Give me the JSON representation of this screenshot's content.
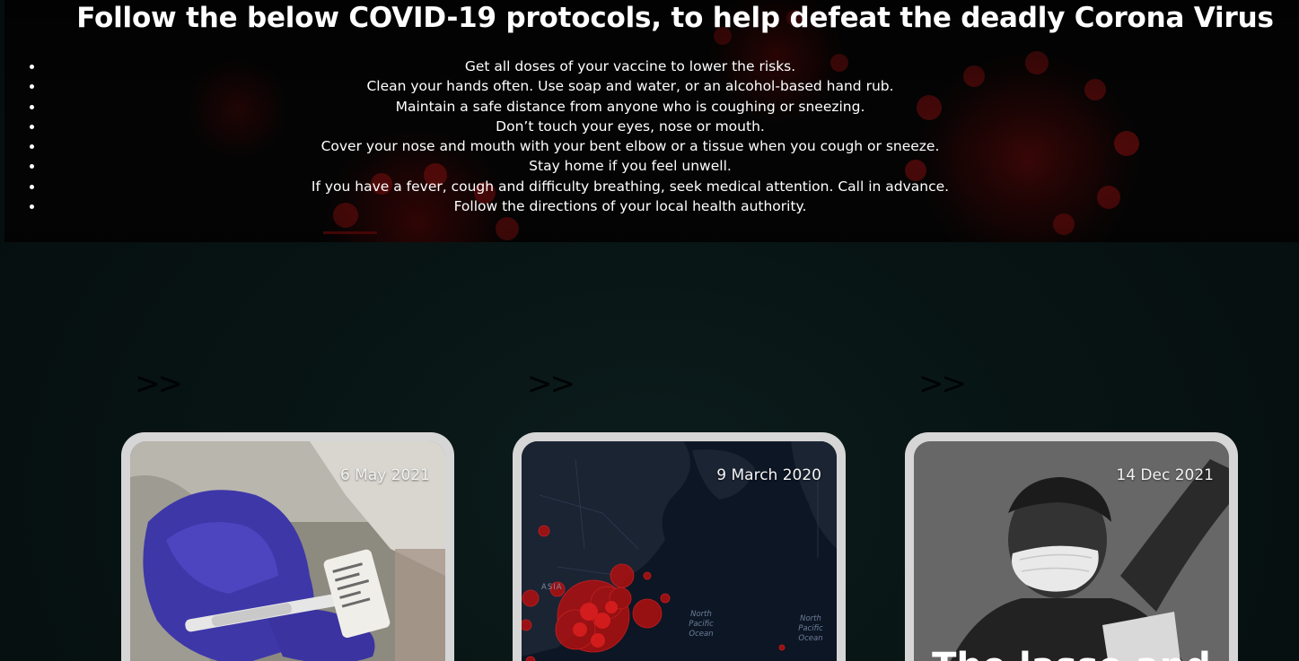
{
  "banner": {
    "title": "Follow the below COVID-19 protocols, to help defeat the deadly Corona Virus",
    "protocols": [
      "Get all doses of your vaccine to lower the risks.",
      "Clean your hands often. Use soap and water, or an alcohol-based hand rub.",
      "Maintain a safe distance from anyone who is coughing or sneezing.",
      "Don’t touch your eyes, nose or mouth.",
      "Cover your nose and mouth with your bent elbow or a tissue when you cough or sneeze.",
      "Stay home if you feel unwell.",
      "If you have a fever, cough and difficulty breathing, seek medical attention. Call in advance.",
      "Follow the directions of your local health authority."
    ]
  },
  "cards": [
    {
      "arrows": ">>",
      "date": "6 May 2021",
      "image": "vaccine-injection-photo"
    },
    {
      "arrows": ">>",
      "date": "9 March 2020",
      "image": "world-map-outbreak-photo",
      "map_labels": [
        "ASIA",
        "North Pacific Ocean",
        "North Pacific Ocean"
      ]
    },
    {
      "arrows": ">>",
      "date": "14 Dec 2021",
      "image": "masked-statue-photo",
      "headline": "The lasso and"
    }
  ],
  "colors": {
    "background": "#071212",
    "banner": "#050505",
    "card_frame": "#d6d6d6",
    "virus_red": "#8a0d0d"
  }
}
